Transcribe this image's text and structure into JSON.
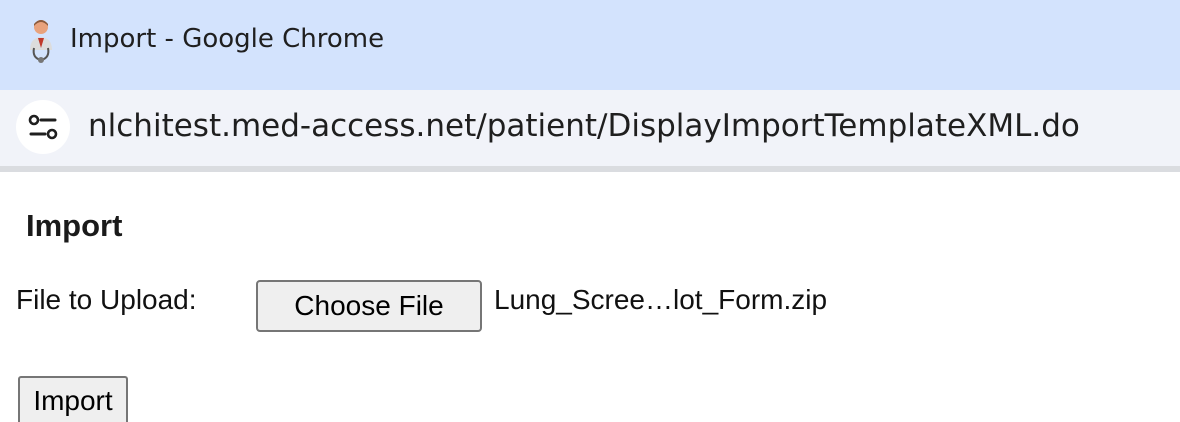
{
  "window": {
    "title": "Import - Google Chrome",
    "icon": "app-doctor-icon"
  },
  "addressbar": {
    "url": "nlchitest.med-access.net/patient/DisplayImportTemplateXML.do",
    "site_info_icon": "tune-icon"
  },
  "page": {
    "heading": "Import",
    "upload_label": "File to Upload:",
    "choose_file_label": "Choose File",
    "file_name": "Lung_Scree…lot_Form.zip",
    "import_label": "Import"
  }
}
